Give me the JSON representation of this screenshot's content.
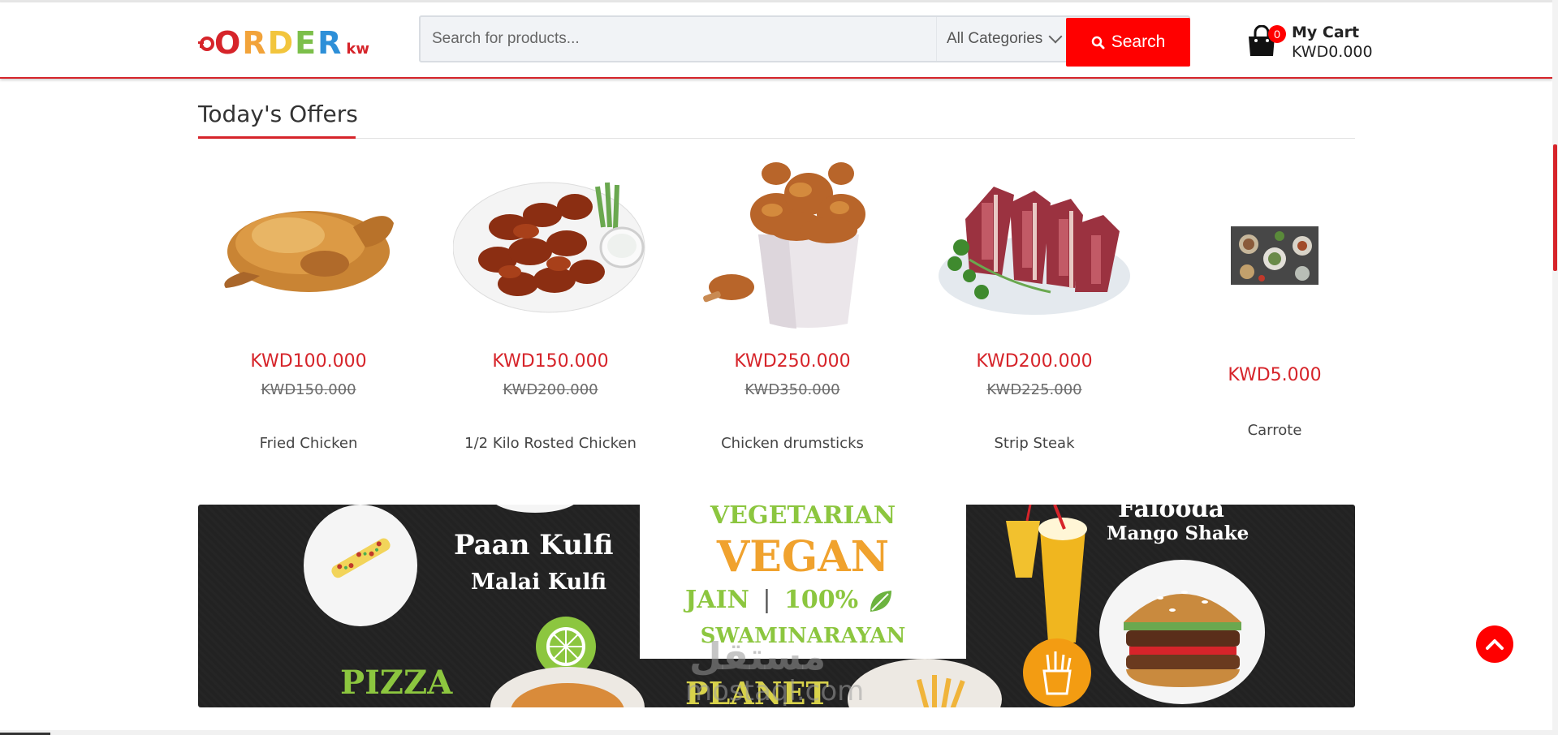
{
  "header": {
    "logo": {
      "letters": [
        "O",
        "R",
        "D",
        "E",
        "R"
      ],
      "suffix": "kw"
    },
    "search": {
      "placeholder": "Search for products...",
      "category": "All Categories",
      "button_label": "Search"
    },
    "cart": {
      "title": "My Cart",
      "count": "0",
      "total": "KWD0.000"
    }
  },
  "offers": {
    "title": "Today's Offers",
    "products": [
      {
        "name": "Fried Chicken",
        "price": "KWD100.000",
        "old_price": "KWD150.000",
        "image": "roast-chicken"
      },
      {
        "name": "1/2 Kilo Rosted Chicken",
        "price": "KWD150.000",
        "old_price": "KWD200.000",
        "image": "chicken-wings"
      },
      {
        "name": "Chicken drumsticks",
        "price": "KWD250.000",
        "old_price": "KWD350.000",
        "image": "chicken-bucket"
      },
      {
        "name": "Strip Steak",
        "price": "KWD200.000",
        "old_price": "KWD225.000",
        "image": "raw-steak"
      },
      {
        "name": "Carrote",
        "price": "KWD5.000",
        "old_price": "",
        "image": "dishes-thumbnail"
      }
    ]
  },
  "banner": {
    "left_title": "Paan Kulfi",
    "left_subtitle": "Malai Kulfi",
    "pizza": "PIZZA",
    "planet": "PLANET",
    "center_lines": [
      "VEGETARIAN",
      "VEGAN",
      "JAIN",
      "100%",
      "SWAMINARAYAN"
    ],
    "right_title": "Falooda",
    "right_subtitle": "Mango Shake",
    "watermark_ar": "مستقل",
    "watermark": "mostaql.com"
  },
  "colors": {
    "accent": "#d6242a",
    "search_button": "#ff0000",
    "price": "#d6242a"
  }
}
